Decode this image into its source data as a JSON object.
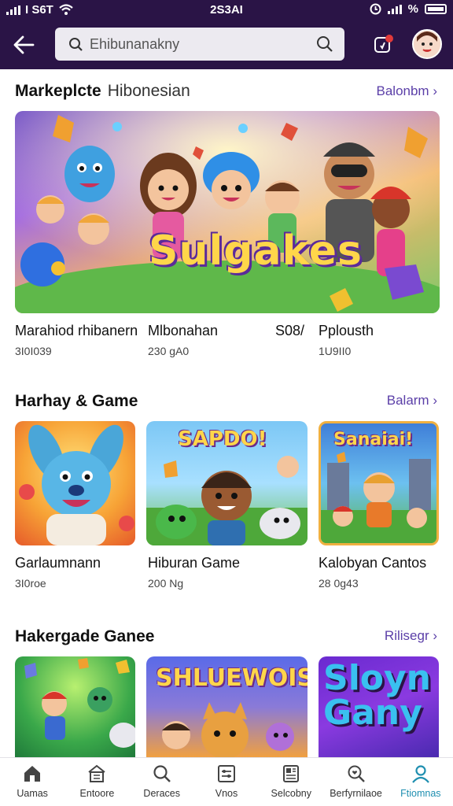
{
  "status_bar": {
    "carrier": "I S6T",
    "time": "2S3AI",
    "battery": "%"
  },
  "search": {
    "placeholder": "Ehibunanakny"
  },
  "sections": [
    {
      "title": "Markeplcte",
      "subtitle": "Hibonesian",
      "link": "Balonbm"
    },
    {
      "title": "Harhay & Game",
      "link": "Balarm"
    },
    {
      "title": "Hakergade Ganee",
      "link": "Rilisegr"
    }
  ],
  "hero": {
    "logo_text": "Sulgakes",
    "items": [
      {
        "title": "Marahiod rhibanern",
        "meta": "3I0I039"
      },
      {
        "title": "Mlbonahan",
        "meta": "230 gA0"
      },
      {
        "title": "S08/",
        "meta": ""
      },
      {
        "title": "Pplousth",
        "meta": "1U9II0"
      }
    ]
  },
  "games_row": [
    {
      "title": "Garlaumnann",
      "meta": "3I0roe",
      "logo_text": ""
    },
    {
      "title": "Hiburan Game",
      "meta": "200 Ng",
      "logo_text": "SAPDO!"
    },
    {
      "title": "Kalobyan Cantos",
      "meta": "28 0g43",
      "logo_text": "Sanaiai!"
    }
  ],
  "bottom_row": [
    {
      "logo_text": ""
    },
    {
      "logo_text": "SHLUEWOIS!"
    },
    {
      "logo_text": "Sloyn Gany"
    }
  ],
  "bottom_nav": [
    {
      "label": "Uamas",
      "icon": "home-icon",
      "active": false
    },
    {
      "label": "Entoore",
      "icon": "store-icon",
      "active": false
    },
    {
      "label": "Deraces",
      "icon": "search-icon",
      "active": false
    },
    {
      "label": "Vnos",
      "icon": "controls-icon",
      "active": false
    },
    {
      "label": "Selcobny",
      "icon": "document-icon",
      "active": false
    },
    {
      "label": "Berfyrnilaoe",
      "icon": "magnify-heart-icon",
      "active": false
    },
    {
      "label": "Ftiomnas",
      "icon": "profile-icon",
      "active": true
    }
  ],
  "colors": {
    "header": "#2a1446",
    "accent_link": "#5b3fa8",
    "active_nav": "#1f8fb0"
  }
}
